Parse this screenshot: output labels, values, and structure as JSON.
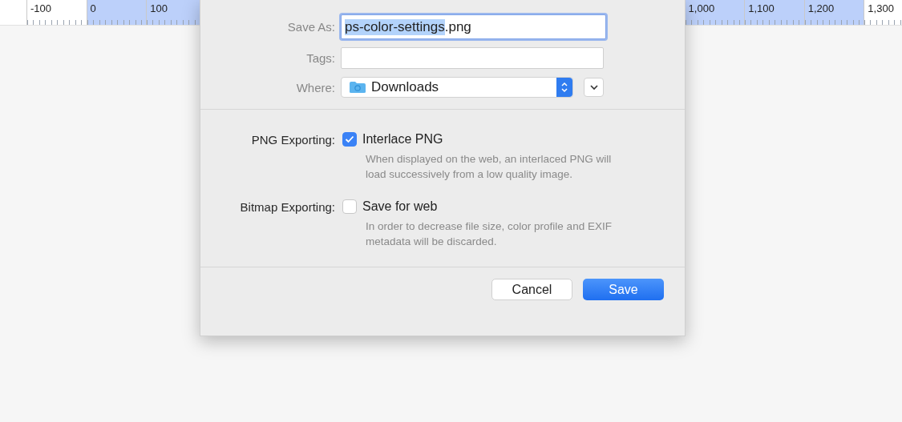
{
  "ruler": {
    "marks": [
      {
        "label": "-100",
        "selected": false
      },
      {
        "label": "0",
        "selected": true
      },
      {
        "label": "100",
        "selected": true
      },
      {
        "label": "1,000",
        "selected": true
      },
      {
        "label": "1,100",
        "selected": true
      },
      {
        "label": "1,200",
        "selected": true
      },
      {
        "label": "1,300",
        "selected": false
      }
    ]
  },
  "dialog": {
    "save_as": {
      "label": "Save As:",
      "segments": [
        {
          "text": "ps-color-settings",
          "selected": true
        },
        {
          "text": ".png",
          "selected": false
        }
      ],
      "focused": true
    },
    "tags": {
      "label": "Tags:"
    },
    "where": {
      "label": "Where:",
      "value": "Downloads"
    },
    "options": [
      {
        "label": "PNG Exporting:",
        "option": "Interlace PNG",
        "checked": true,
        "description": "When displayed on the web, an interlaced PNG will load successively from a low quality image."
      },
      {
        "label": "Bitmap Exporting:",
        "option": "Save for web",
        "checked": false,
        "description": "In order to decrease file size, color profile and EXIF metadata will be discarded."
      }
    ],
    "buttons": [
      {
        "label": "Cancel",
        "kind": "secondary"
      },
      {
        "label": "Save",
        "kind": "primary"
      }
    ]
  }
}
